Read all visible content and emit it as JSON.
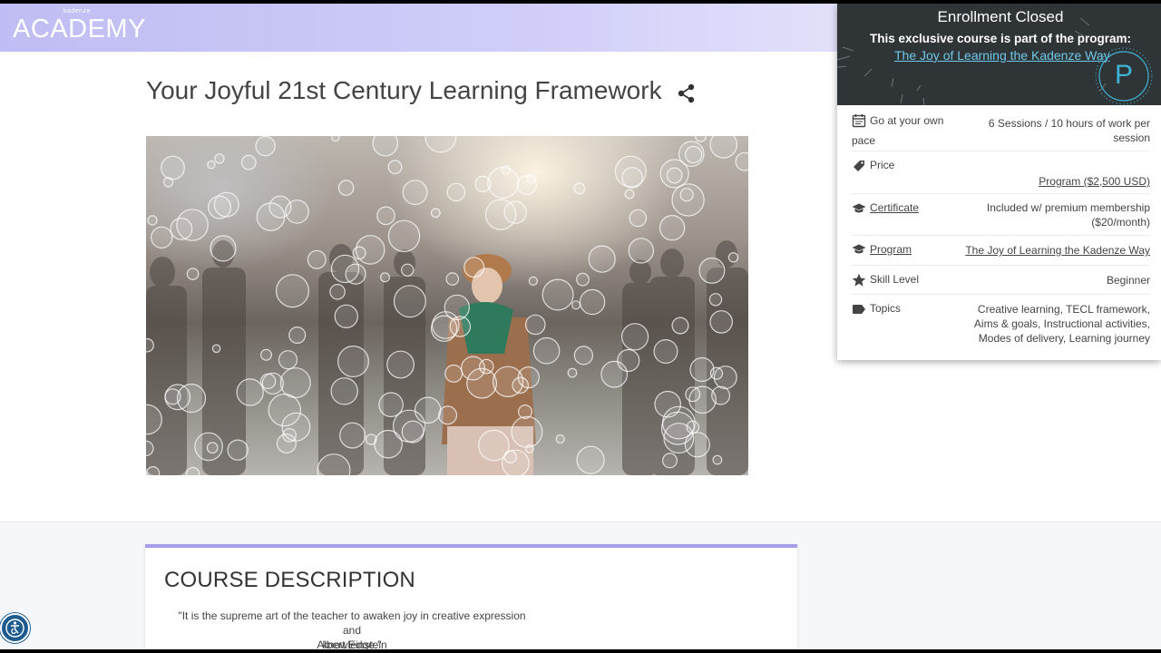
{
  "header": {
    "logo_small": "kadenze",
    "logo_main": "ACADEMY"
  },
  "course": {
    "title": "Your Joyful 21st Century Learning Framework"
  },
  "enrollment": {
    "title": "Enrollment Closed",
    "subtitle": "This exclusive course is part of the program:",
    "program_link": "The Joy of Learning the Kadenze Way",
    "badge_letter": "P"
  },
  "details": {
    "pace": {
      "label_line1": "Go at your own",
      "label_line2": "pace",
      "value_line1": "6 Sessions / 10 hours of work per",
      "value_line2": "session"
    },
    "price": {
      "label": "Price",
      "value": "Program ($2,500 USD)"
    },
    "certificate": {
      "label": "Certificate",
      "value_line1": "Included w/ premium membership",
      "value_line2": "($20/month)"
    },
    "program": {
      "label": "Program",
      "value": "The Joy of Learning the Kadenze Way"
    },
    "skill": {
      "label": "Skill Level",
      "value": "Beginner"
    },
    "topics": {
      "label": "Topics",
      "value_line1": "Creative learning, TECL framework,",
      "value_line2": "Aims & goals, Instructional activities,",
      "value_line3": "Modes of delivery, Learning journey"
    }
  },
  "description": {
    "heading": "COURSE DESCRIPTION",
    "quote_line1": "\"It is the supreme art of the teacher to awaken joy in creative expression and",
    "quote_line2": "knowledge.\"",
    "author": "Albert Einstein"
  },
  "colors": {
    "accent": "#a79ee9",
    "link": "#2b6fa8",
    "enroll_header": "#2f3437",
    "enroll_link": "#6ec9e8"
  }
}
